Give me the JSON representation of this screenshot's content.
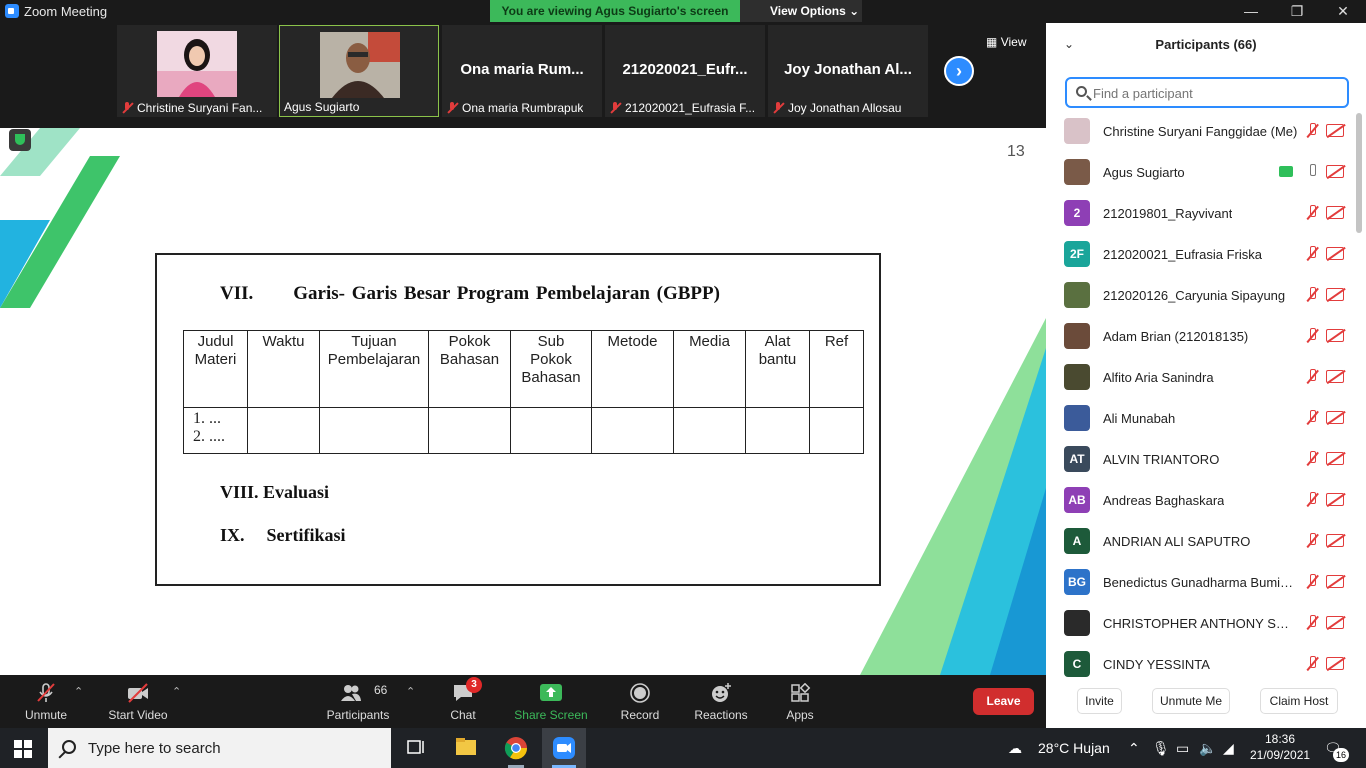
{
  "window": {
    "title": "Zoom Meeting",
    "banner": "You are viewing Agus Sugiarto's screen",
    "view_options": "View Options"
  },
  "strip": {
    "tiles": [
      {
        "name": "Christine Suryani Fan...",
        "muted": true,
        "type": "photo"
      },
      {
        "name": "Agus Sugiarto",
        "muted": false,
        "type": "photo"
      },
      {
        "display": "Ona maria Rum...",
        "name": "Ona maria Rumbrapuk",
        "muted": true
      },
      {
        "display": "212020021_Eufr...",
        "name": "212020021_Eufrasia F...",
        "muted": true
      },
      {
        "display": "Joy Jonathan Al...",
        "name": "Joy Jonathan Allosau",
        "muted": true
      }
    ],
    "view_label": "View"
  },
  "slide": {
    "page_number": "13",
    "section_vii": "VII.",
    "heading": "Garis- Garis Besar Program Pembelajaran (GBPP)",
    "table_headers": [
      {
        "line1": "Judul",
        "line2": "Materi",
        "line3": ""
      },
      {
        "line1": "Waktu",
        "line2": "",
        "line3": ""
      },
      {
        "line1": "Tujuan",
        "line2": "Pembelajaran",
        "line3": ""
      },
      {
        "line1": "Pokok",
        "line2": "Bahasan",
        "line3": ""
      },
      {
        "line1": "Sub",
        "line2": "Pokok",
        "line3": "Bahasan"
      },
      {
        "line1": "Metode",
        "line2": "",
        "line3": ""
      },
      {
        "line1": "Media",
        "line2": "",
        "line3": ""
      },
      {
        "line1": "Alat",
        "line2": "bantu",
        "line3": ""
      },
      {
        "line1": "Ref",
        "line2": "",
        "line3": ""
      }
    ],
    "first_cell": {
      "line1": "1. ...",
      "line2": "2. ...."
    },
    "section_viii": "VIII. Evaluasi",
    "section_ix_num": "IX.",
    "section_ix_label": "Sertifikasi"
  },
  "panel": {
    "title": "Participants (66)",
    "search_placeholder": "Find a participant",
    "participants": [
      {
        "name": "Christine Suryani Fanggidae (Me)",
        "initials": "",
        "color": "#d9c2c8",
        "mic_on": false
      },
      {
        "name": "Agus Sugiarto",
        "initials": "",
        "color": "#7a5a48",
        "mic_on": true,
        "sharing": true
      },
      {
        "name": "212019801_Rayvivant",
        "initials": "2",
        "color": "#8e3fb5",
        "mic_on": false
      },
      {
        "name": "212020021_Eufrasia Friska",
        "initials": "2F",
        "color": "#1aa59a",
        "mic_on": false
      },
      {
        "name": "212020126_Caryunia Sipayung",
        "initials": "",
        "color": "#5a7040",
        "mic_on": false
      },
      {
        "name": "Adam Brian (212018135)",
        "initials": "",
        "color": "#6b4b3a",
        "mic_on": false
      },
      {
        "name": "Alfito Aria Sanindra",
        "initials": "",
        "color": "#4a4a30",
        "mic_on": false
      },
      {
        "name": "Ali Munabah",
        "initials": "",
        "color": "#3b5b9a",
        "mic_on": false
      },
      {
        "name": "ALVIN TRIANTORO",
        "initials": "AT",
        "color": "#3a4a5c",
        "mic_on": false
      },
      {
        "name": "Andreas Baghaskara",
        "initials": "AB",
        "color": "#8e3fb5",
        "mic_on": false
      },
      {
        "name": "ANDRIAN ALI SAPUTRO",
        "initials": "A",
        "color": "#1d5a3a",
        "mic_on": false
      },
      {
        "name": "Benedictus Gunadharma Bumisa...",
        "initials": "BG",
        "color": "#2d73c9",
        "mic_on": false
      },
      {
        "name": "CHRISTOPHER ANTHONY SURY...",
        "initials": "",
        "color": "#2a2a2a",
        "mic_on": false
      },
      {
        "name": "CINDY YESSINTA",
        "initials": "C",
        "color": "#1d5a3a",
        "mic_on": false
      }
    ],
    "buttons": {
      "invite": "Invite",
      "unmute_me": "Unmute Me",
      "claim_host": "Claim Host"
    }
  },
  "toolbar": {
    "unmute": "Unmute",
    "start_video": "Start Video",
    "participants": "Participants",
    "participants_count": "66",
    "chat": "Chat",
    "chat_badge": "3",
    "share_screen": "Share Screen",
    "record": "Record",
    "reactions": "Reactions",
    "apps": "Apps",
    "leave": "Leave"
  },
  "taskbar": {
    "search_placeholder": "Type here to search",
    "weather": "28°C  Hujan",
    "time": "18:36",
    "date": "21/09/2021",
    "notification_count": "16"
  }
}
